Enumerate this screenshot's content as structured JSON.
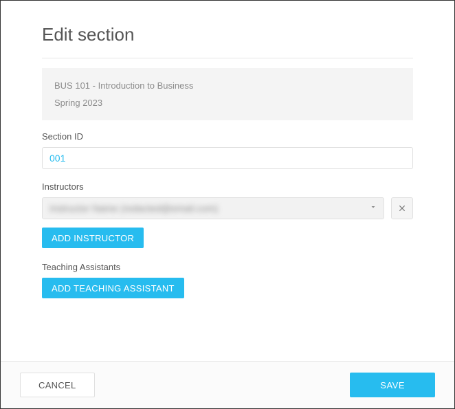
{
  "modal": {
    "title": "Edit section"
  },
  "course": {
    "title": "BUS 101 - Introduction to Business",
    "term": "Spring 2023"
  },
  "section": {
    "id_label": "Section ID",
    "id_value": "001"
  },
  "instructors": {
    "label": "Instructors",
    "selected": "Instructor Name (redacted@email.com)",
    "add_button": "ADD INSTRUCTOR"
  },
  "teaching_assistants": {
    "label": "Teaching Assistants",
    "add_button": "ADD TEACHING ASSISTANT"
  },
  "footer": {
    "cancel": "CANCEL",
    "save": "SAVE"
  }
}
